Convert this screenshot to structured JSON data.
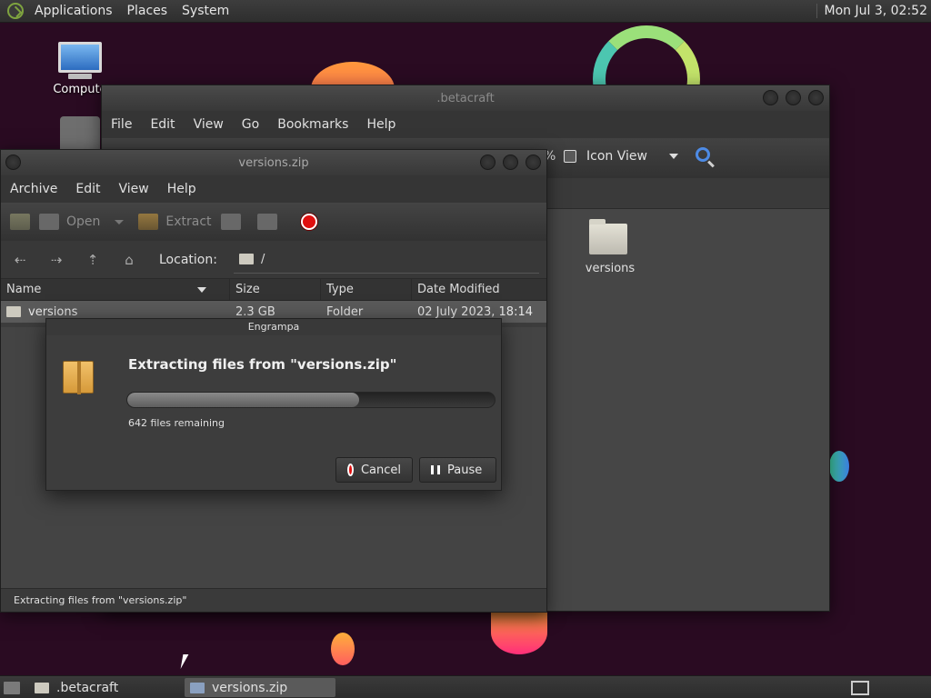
{
  "top_panel": {
    "menus": [
      "Applications",
      "Places",
      "System"
    ],
    "clock": "Mon Jul  3, 02:52"
  },
  "desktop": {
    "computer_label": "Compute"
  },
  "betacraft_window": {
    "title": ".betacraft",
    "menus": [
      "File",
      "Edit",
      "View",
      "Go",
      "Bookmarks",
      "Help"
    ],
    "zoom": "%",
    "view_mode": "Icon View",
    "folder_label": "versions"
  },
  "versions_window": {
    "title": "versions.zip",
    "menus": [
      "Archive",
      "Edit",
      "View",
      "Help"
    ],
    "toolbar": {
      "open": "Open",
      "extract": "Extract"
    },
    "location_label": "Location:",
    "location_value": "/",
    "columns": {
      "name": "Name",
      "size": "Size",
      "type": "Type",
      "date": "Date Modified"
    },
    "row": {
      "name": "versions",
      "size": "2.3 GB",
      "type": "Folder",
      "date": "02 July 2023, 18:14"
    },
    "status": "Extracting files from \"versions.zip\""
  },
  "dialog": {
    "title": "Engrampa",
    "heading": "Extracting files from \"versions.zip\"",
    "progress": 0.63,
    "remaining": "642 files remaining",
    "cancel": "Cancel",
    "pause": "Pause"
  },
  "taskbar": {
    "items": [
      ".betacraft",
      "versions.zip"
    ]
  }
}
